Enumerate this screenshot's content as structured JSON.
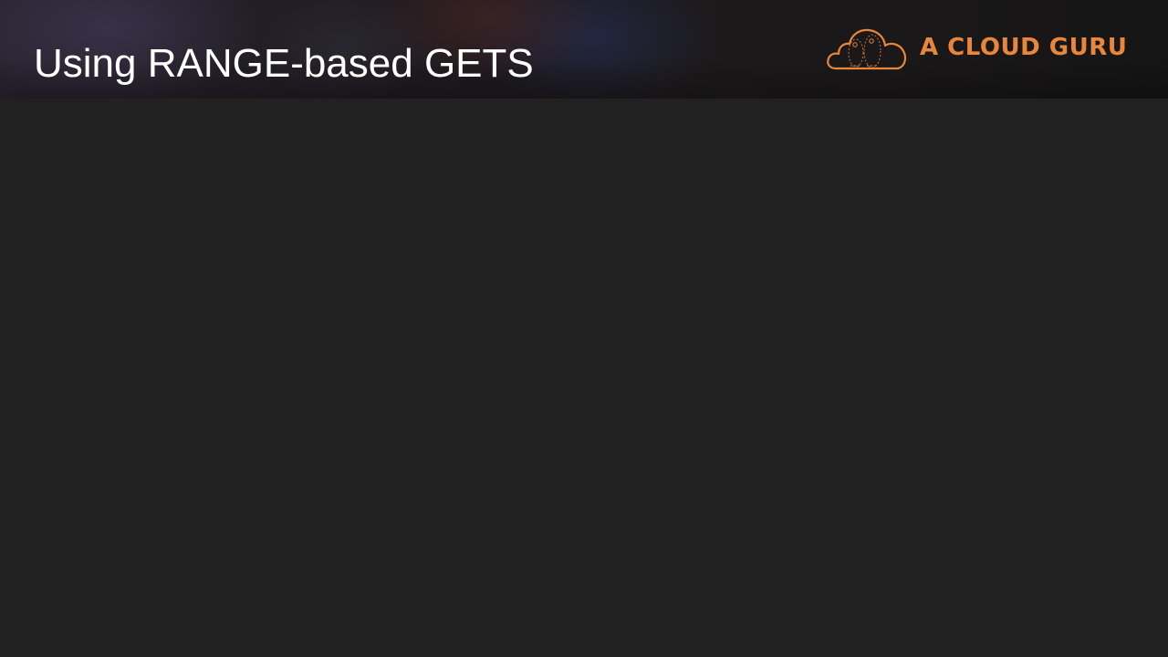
{
  "slide": {
    "title": "Using RANGE-based GETS"
  },
  "brand": {
    "name": "A CLOUD GURU",
    "logo_icon": "cloud-logo-icon",
    "accent_color": "#e8863c"
  },
  "colors": {
    "background": "#212121",
    "title_text": "#ffffff"
  }
}
